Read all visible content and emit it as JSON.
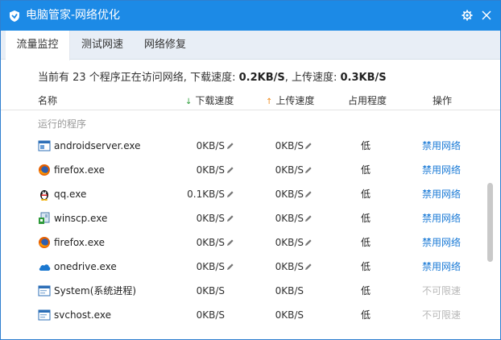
{
  "window": {
    "title": "电脑管家-网络优化",
    "colors": {
      "titlebar": "#1c8ae6",
      "link": "#1a7ad6",
      "disabled": "#b8b8b8"
    }
  },
  "tabs": [
    {
      "label": "流量监控",
      "active": true
    },
    {
      "label": "测试网速",
      "active": false
    },
    {
      "label": "网络修复",
      "active": false
    }
  ],
  "summary": {
    "prefix": "当前有 23 个程序正在访问网络, 下载速度: ",
    "download": "0.2KB/S",
    "mid": ", 上传速度: ",
    "upload": "0.3KB/S"
  },
  "columns": {
    "name": "名称",
    "download": "下载速度",
    "upload": "上传速度",
    "usage": "占用程度",
    "operation": "操作"
  },
  "group_label": "运行的程序",
  "rows": [
    {
      "icon": "androidserver-icon",
      "name": "androidserver.exe",
      "download": "0KB/S",
      "upload": "0KB/S",
      "usage": "低",
      "action": "禁用网络",
      "editable": true,
      "action_enabled": true
    },
    {
      "icon": "firefox-icon",
      "name": "firefox.exe",
      "download": "0KB/S",
      "upload": "0KB/S",
      "usage": "低",
      "action": "禁用网络",
      "editable": true,
      "action_enabled": true
    },
    {
      "icon": "qq-penguin-icon",
      "name": "qq.exe",
      "download": "0.1KB/S",
      "upload": "0KB/S",
      "usage": "低",
      "action": "禁用网络",
      "editable": true,
      "action_enabled": true
    },
    {
      "icon": "winscp-icon",
      "name": "winscp.exe",
      "download": "0KB/S",
      "upload": "0KB/S",
      "usage": "低",
      "action": "禁用网络",
      "editable": true,
      "action_enabled": true
    },
    {
      "icon": "firefox-icon",
      "name": "firefox.exe",
      "download": "0KB/S",
      "upload": "0KB/S",
      "usage": "低",
      "action": "禁用网络",
      "editable": true,
      "action_enabled": true
    },
    {
      "icon": "onedrive-cloud-icon",
      "name": "onedrive.exe",
      "download": "0KB/S",
      "upload": "0KB/S",
      "usage": "低",
      "action": "禁用网络",
      "editable": true,
      "action_enabled": true
    },
    {
      "icon": "system-window-icon",
      "name": "System(系统进程)",
      "download": "0KB/S",
      "upload": "0KB/S",
      "usage": "低",
      "action": "不可限速",
      "editable": false,
      "action_enabled": false
    },
    {
      "icon": "system-window-icon",
      "name": "svchost.exe",
      "download": "0KB/S",
      "upload": "0KB/S",
      "usage": "低",
      "action": "不可限速",
      "editable": false,
      "action_enabled": false
    }
  ]
}
